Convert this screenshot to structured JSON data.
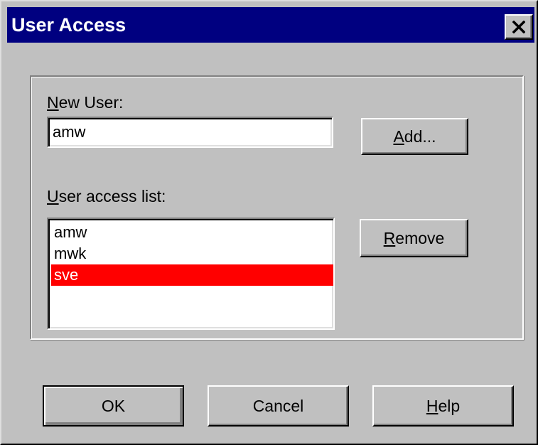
{
  "window": {
    "title": "User Access"
  },
  "icons": {
    "close": "close-icon"
  },
  "new_user": {
    "label_accel": "N",
    "label_rest": "ew User:",
    "value": "amw"
  },
  "access_list": {
    "label_accel": "U",
    "label_rest": "ser access list:",
    "items": [
      {
        "label": "amw",
        "selected": false
      },
      {
        "label": "mwk",
        "selected": false
      },
      {
        "label": "sve",
        "selected": true
      }
    ]
  },
  "buttons": {
    "add_accel": "A",
    "add_rest": "dd...",
    "remove_accel": "R",
    "remove_rest": "emove",
    "ok": "OK",
    "cancel": "Cancel",
    "help_accel": "H",
    "help_rest": "elp"
  },
  "colors": {
    "title_bar": "#000080",
    "face": "#c0c0c0",
    "selection": "#ff0000"
  }
}
